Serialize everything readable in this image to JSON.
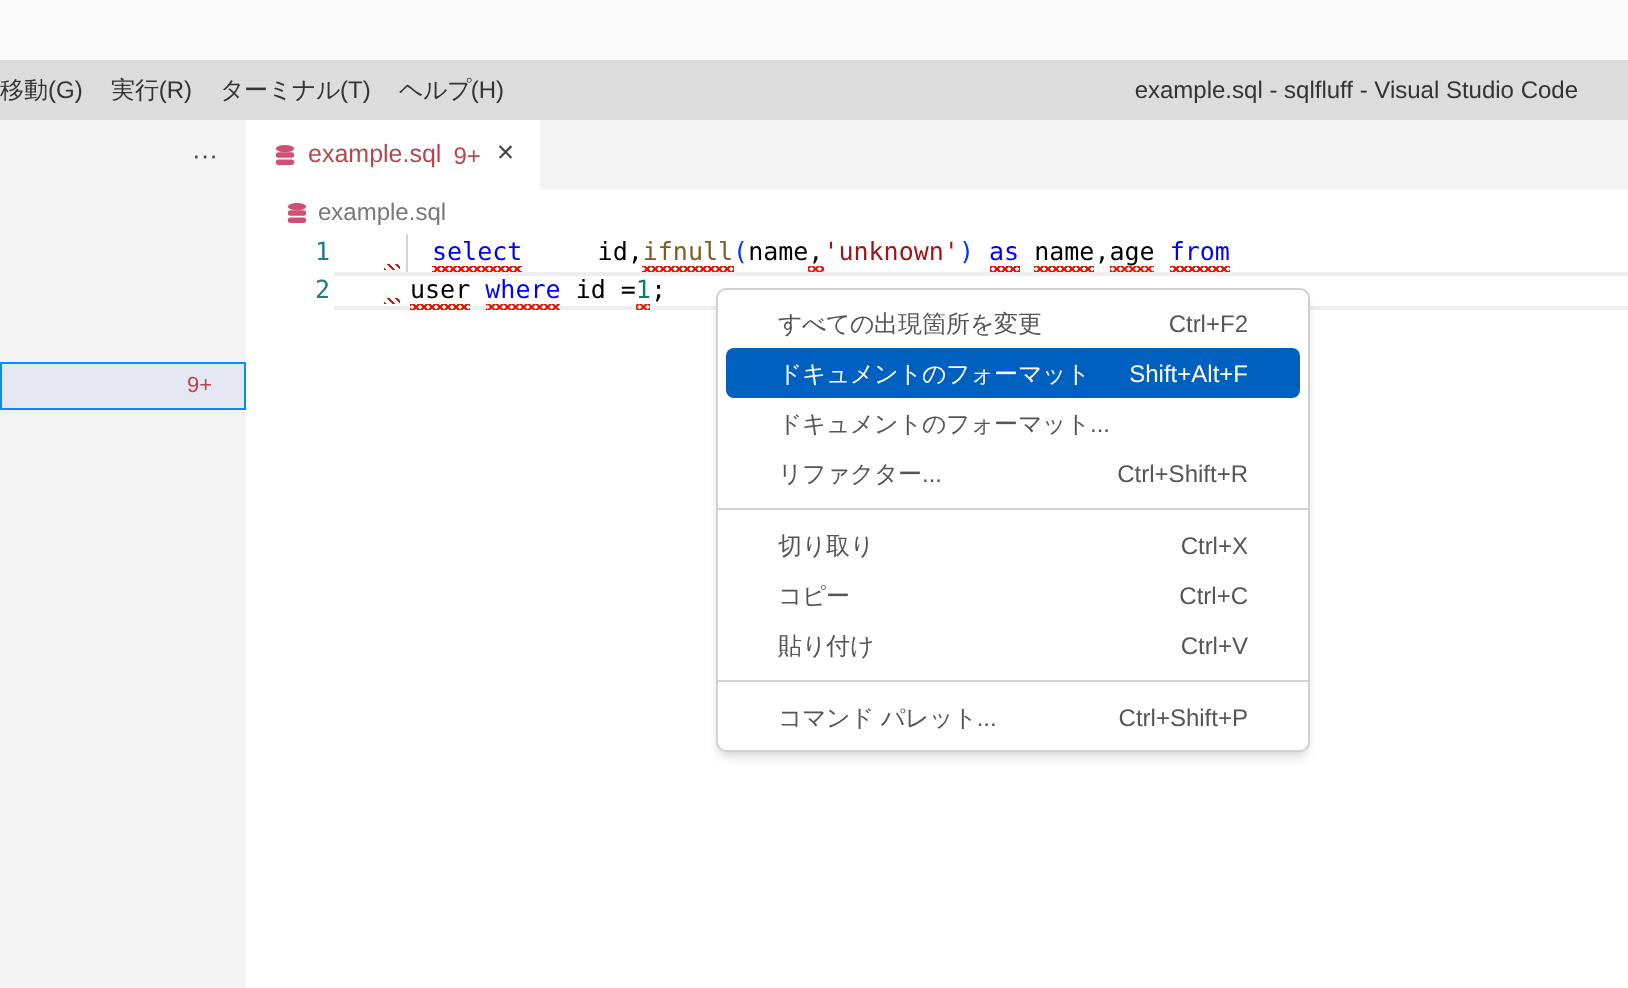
{
  "menu_bar": {
    "items": [
      "移動(G)",
      "実行(R)",
      "ターミナル(T)",
      "ヘルプ(H)"
    ],
    "title": "example.sql - sqlfluff - Visual Studio Code"
  },
  "sidebar": {
    "more": "···",
    "rows": [
      {
        "badge": "9+",
        "selected": true
      }
    ]
  },
  "tabs": [
    {
      "label": "example.sql",
      "badge": "9+",
      "close": "×",
      "selected": true
    }
  ],
  "breadcrumb": "example.sql",
  "editor": {
    "lines": [
      {
        "number": "1",
        "current": false,
        "lead_squiggle": true,
        "indent_guide": true,
        "tokens": [
          {
            "text": "select",
            "kind": "keyword",
            "squiggle": true
          },
          {
            "text": "     id,",
            "kind": "plain",
            "squiggle": false
          },
          {
            "text": "ifnull",
            "kind": "function",
            "squiggle": true
          },
          {
            "text": "(",
            "kind": "bracket",
            "squiggle": false
          },
          {
            "text": "name",
            "kind": "plain",
            "squiggle": false
          },
          {
            "text": ",",
            "kind": "plain",
            "squiggle": true
          },
          {
            "text": "'unknown'",
            "kind": "string",
            "squiggle": false
          },
          {
            "text": ") ",
            "kind": "bracket",
            "squiggle": false
          },
          {
            "text": "as ",
            "kind": "keyword",
            "squiggle": true
          },
          {
            "text": "name",
            "kind": "plain",
            "squiggle": true
          },
          {
            "text": ",",
            "kind": "plain",
            "squiggle": false
          },
          {
            "text": "age ",
            "kind": "plain",
            "squiggle": true
          },
          {
            "text": "from",
            "kind": "keyword",
            "squiggle": true
          }
        ]
      },
      {
        "number": "2",
        "current": true,
        "lead_squiggle": true,
        "indent_guide": false,
        "tokens": [
          {
            "text": "user ",
            "kind": "plain",
            "squiggle": true
          },
          {
            "text": "where",
            "kind": "keyword",
            "squiggle": true
          },
          {
            "text": " id =",
            "kind": "plain",
            "squiggle": false
          },
          {
            "text": "1",
            "kind": "number",
            "squiggle": true
          },
          {
            "text": ";",
            "kind": "plain",
            "squiggle": false
          }
        ]
      }
    ]
  },
  "context_menu": [
    {
      "kind": "item",
      "label": "すべての出現箇所を変更",
      "shortcut": "Ctrl+F2",
      "selected": false
    },
    {
      "kind": "item",
      "label": "ドキュメントのフォーマット",
      "shortcut": "Shift+Alt+F",
      "selected": true
    },
    {
      "kind": "item",
      "label": "ドキュメントのフォーマット...",
      "selected": false
    },
    {
      "kind": "item",
      "label": "リファクター...",
      "shortcut": "Ctrl+Shift+R",
      "selected": false
    },
    {
      "kind": "separator"
    },
    {
      "kind": "item",
      "label": "切り取り",
      "shortcut": "Ctrl+X",
      "selected": false
    },
    {
      "kind": "item",
      "label": "コピー",
      "shortcut": "Ctrl+C",
      "selected": false
    },
    {
      "kind": "item",
      "label": "貼り付け",
      "shortcut": "Ctrl+V",
      "selected": false
    },
    {
      "kind": "separator"
    },
    {
      "kind": "item",
      "label": "コマンド パレット...",
      "shortcut": "Ctrl+Shift+P",
      "selected": false
    }
  ]
}
